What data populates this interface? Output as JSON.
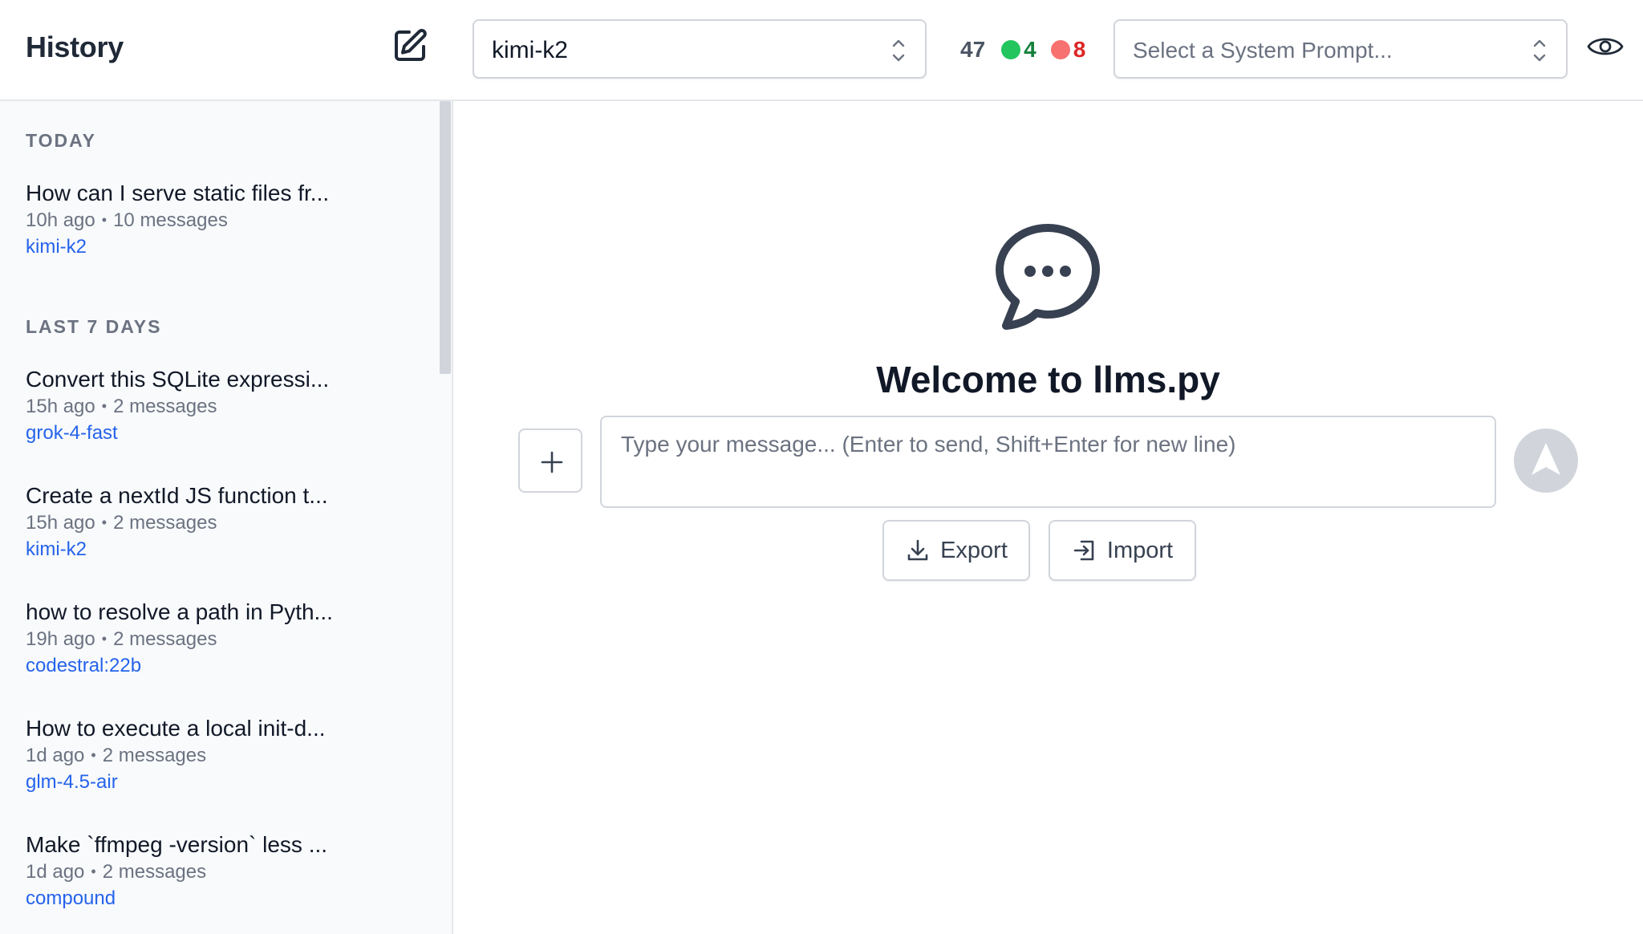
{
  "sidebar": {
    "title": "History",
    "sections": [
      {
        "label": "TODAY",
        "items": [
          {
            "title": "How can I serve static files fr...",
            "time": "10h ago",
            "messages": "10 messages",
            "model": "kimi-k2"
          }
        ]
      },
      {
        "label": "LAST 7 DAYS",
        "items": [
          {
            "title": "Convert this SQLite expressi...",
            "time": "15h ago",
            "messages": "2 messages",
            "model": "grok-4-fast"
          },
          {
            "title": "Create a nextId JS function t...",
            "time": "15h ago",
            "messages": "2 messages",
            "model": "kimi-k2"
          },
          {
            "title": "how to resolve a path in Pyth...",
            "time": "19h ago",
            "messages": "2 messages",
            "model": "codestral:22b"
          },
          {
            "title": "How to execute a local init-d...",
            "time": "1d ago",
            "messages": "2 messages",
            "model": "glm-4.5-air"
          },
          {
            "title": "Make `ffmpeg -version` less ...",
            "time": "1d ago",
            "messages": "2 messages",
            "model": "compound"
          }
        ]
      }
    ],
    "separator": "•"
  },
  "topbar": {
    "model_value": "kimi-k2",
    "counts": {
      "total": "47",
      "ok": "4",
      "err": "8"
    },
    "system_prompt_placeholder": "Select a System Prompt..."
  },
  "main": {
    "welcome_title": "Welcome to llms.py",
    "input_placeholder": "Type your message... (Enter to send, Shift+Enter for new line)",
    "export_label": "Export",
    "import_label": "Import"
  },
  "icons": {
    "new_chat": "edit-square-icon",
    "chevrons": "chevron-up-down-icon",
    "eye": "eye-icon",
    "chat_bubble": "chat-bubble-dots-icon",
    "plus": "plus-icon",
    "send": "send-arrow-icon",
    "download": "download-icon",
    "import": "import-icon"
  },
  "colors": {
    "link": "#2563eb",
    "ok": "#22c55e",
    "err": "#f87171",
    "sidebar_bg": "#f8fafc"
  }
}
